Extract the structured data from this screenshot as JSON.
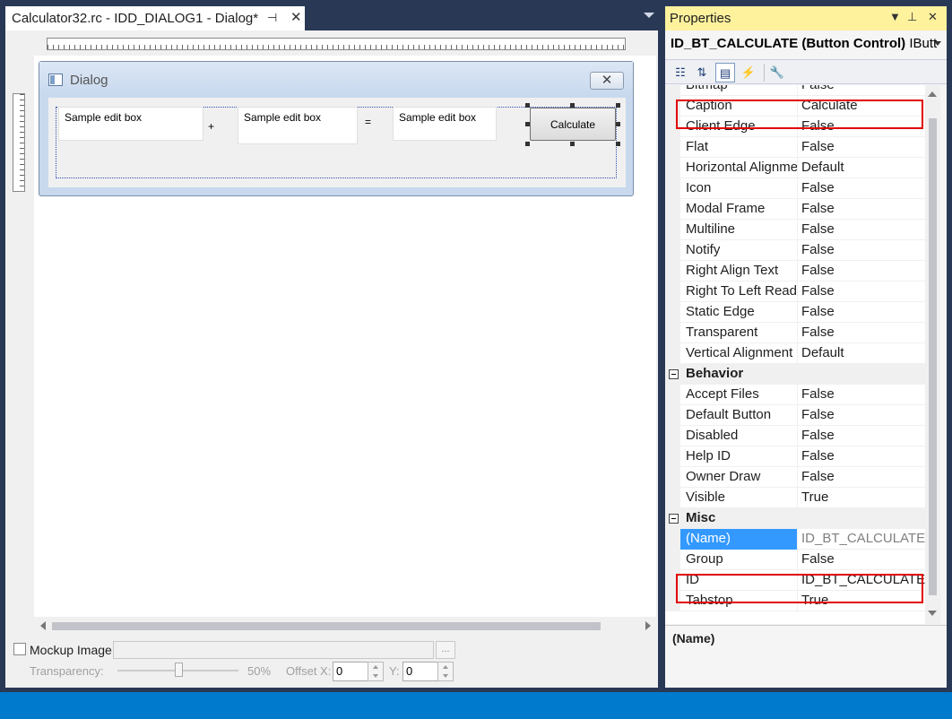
{
  "document_tab": {
    "title": "Calculator32.rc - IDD_DIALOG1 - Dialog*",
    "pin_icon": "pin-icon",
    "close_icon": "close-icon"
  },
  "dialog": {
    "title": "Dialog",
    "close_glyph": "✕",
    "edit_boxes": [
      "Sample edit box",
      "Sample edit box",
      "Sample edit box"
    ],
    "operators": [
      "+",
      "="
    ],
    "button_label": "Calculate"
  },
  "mockup": {
    "checkbox_label": "Mockup Image:",
    "browse_label": "...",
    "transparency_label": "Transparency:",
    "transparency_value": "50%",
    "transparency_level": 0.5,
    "offset_x_label": "Offset X:",
    "offset_x_value": "0",
    "offset_y_label": "Y:",
    "offset_y_value": "0"
  },
  "properties": {
    "header": "Properties",
    "object_name": "ID_BT_CALCULATE (Button Control)",
    "object_type": "IButt",
    "description_title": "(Name)",
    "rows": [
      {
        "name": "Bitmap",
        "value": "False"
      },
      {
        "name": "Caption",
        "value": "Calculate"
      },
      {
        "name": "Client Edge",
        "value": "False"
      },
      {
        "name": "Flat",
        "value": "False"
      },
      {
        "name": "Horizontal Alignment",
        "value": "Default"
      },
      {
        "name": "Icon",
        "value": "False"
      },
      {
        "name": "Modal Frame",
        "value": "False"
      },
      {
        "name": "Multiline",
        "value": "False"
      },
      {
        "name": "Notify",
        "value": "False"
      },
      {
        "name": "Right Align Text",
        "value": "False"
      },
      {
        "name": "Right To Left Reading",
        "value": "False"
      },
      {
        "name": "Static Edge",
        "value": "False"
      },
      {
        "name": "Transparent",
        "value": "False"
      },
      {
        "name": "Vertical Alignment",
        "value": "Default"
      },
      {
        "category": "Behavior"
      },
      {
        "name": "Accept Files",
        "value": "False"
      },
      {
        "name": "Default Button",
        "value": "False"
      },
      {
        "name": "Disabled",
        "value": "False"
      },
      {
        "name": "Help ID",
        "value": "False"
      },
      {
        "name": "Owner Draw",
        "value": "False"
      },
      {
        "name": "Visible",
        "value": "True"
      },
      {
        "category": "Misc"
      },
      {
        "name": "(Name)",
        "value": "ID_BT_CALCULATE (Button Control)",
        "selected": true
      },
      {
        "name": "Group",
        "value": "False"
      },
      {
        "name": "ID",
        "value": "ID_BT_CALCULATE"
      },
      {
        "name": "Tabstop",
        "value": "True"
      }
    ]
  },
  "colors": {
    "accent": "#007acc",
    "header_yellow": "#fff29d",
    "selection": "#3399ff",
    "highlight": "#e00000",
    "chrome": "#293955"
  }
}
